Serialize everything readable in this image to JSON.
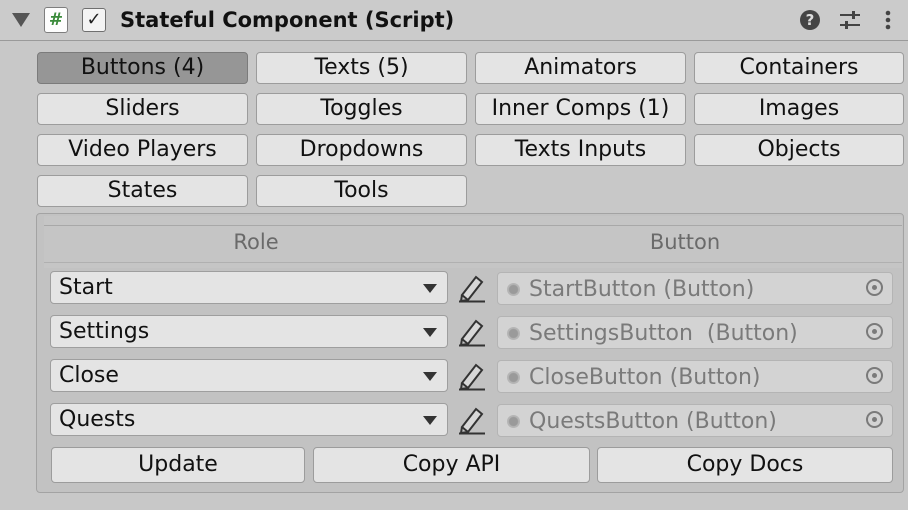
{
  "header": {
    "script_glyph": "#",
    "enabled_check": "✓",
    "title": "Stateful Component (Script)",
    "help_glyph": "?"
  },
  "tabs": [
    {
      "label": "Buttons (4)",
      "active": true
    },
    {
      "label": "Texts (5)",
      "active": false
    },
    {
      "label": "Animators",
      "active": false
    },
    {
      "label": "Containers",
      "active": false
    },
    {
      "label": "Sliders",
      "active": false
    },
    {
      "label": "Toggles",
      "active": false
    },
    {
      "label": "Inner Comps (1)",
      "active": false
    },
    {
      "label": "Images",
      "active": false
    },
    {
      "label": "Video Players",
      "active": false
    },
    {
      "label": "Dropdowns",
      "active": false
    },
    {
      "label": "Texts Inputs",
      "active": false
    },
    {
      "label": "Objects",
      "active": false
    },
    {
      "label": "States",
      "active": false
    },
    {
      "label": "Tools",
      "active": false
    }
  ],
  "table": {
    "headers": {
      "role": "Role",
      "button": "Button"
    },
    "rows": [
      {
        "role": "Start",
        "button": "StartButton (Button)"
      },
      {
        "role": "Settings",
        "button": "SettingsButton  (Button)"
      },
      {
        "role": "Close",
        "button": "CloseButton (Button)"
      },
      {
        "role": "Quests",
        "button": "QuestsButton (Button)"
      }
    ]
  },
  "actions": {
    "update": "Update",
    "copy_api": "Copy API",
    "copy_docs": "Copy Docs"
  }
}
